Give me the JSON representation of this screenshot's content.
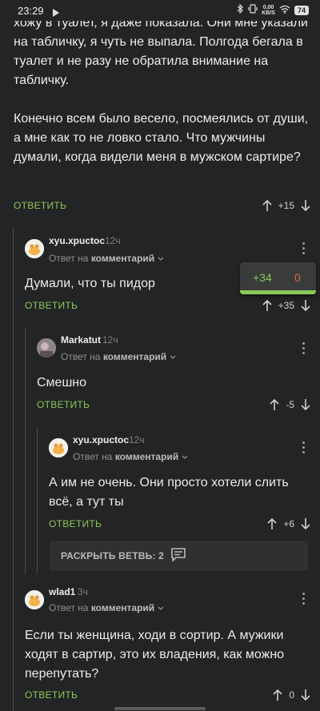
{
  "status_bar": {
    "time": "23:29",
    "net_speed_value": "0,00",
    "net_speed_unit": "KB/S",
    "battery": "74"
  },
  "top_comment": {
    "paragraph1": "хожу в туалет, я даже показала. Они мне указали на табличку, я чуть не выпала. Полгода бегала в туалет и не разу не обратила внимание на табличку.",
    "paragraph2": "Конечно всем было весело, посмеялись от души, а мне как то не ловко стало. Что мужчины думали, когда видели меня в мужском сартире?",
    "reply_label": "ОТВЕТИТЬ",
    "rating": "+15"
  },
  "comments": [
    {
      "author": "xyu.xpuctoc",
      "time": "12ч",
      "reply_prefix": "Ответ на",
      "reply_target": "комментарий",
      "text": "Думали, что ты пидор",
      "reply_label": "ОТВЕТИТЬ",
      "rating": "+35",
      "popup_positive": "+34",
      "popup_negative": "0"
    },
    {
      "author": "Markatut",
      "time": "12ч",
      "reply_prefix": "Ответ на",
      "reply_target": "комментарий",
      "text": "Смешно",
      "reply_label": "ОТВЕТИТЬ",
      "rating": "-5"
    },
    {
      "author": "xyu.xpuctoc",
      "time": "12ч",
      "reply_prefix": "Ответ на",
      "reply_target": "комментарий",
      "text": "А им не очень. Они просто хотели слить всё, а тут ты",
      "reply_label": "ОТВЕТИТЬ",
      "rating": "+6"
    },
    {
      "author": "wlad1",
      "time": "3ч",
      "reply_prefix": "Ответ на",
      "reply_target": "комментарий",
      "text": "Если ты женщина, ходи в сортир. А мужики ходят в сартир, это их владения, как можно перепутать?",
      "reply_label": "ОТВЕТИТЬ",
      "rating": "0"
    }
  ],
  "expand_branch": {
    "label": "РАСКРЫТЬ ВЕТВЬ: 2"
  },
  "colors": {
    "background": "#232425",
    "accent_green": "#8ac858",
    "negative_orange": "#e06b3d"
  },
  "icons": [
    "play-icon",
    "bluetooth-icon",
    "vibrate-icon",
    "wifi-icon",
    "battery-icon",
    "arrow-up-icon",
    "arrow-down-icon",
    "more-vertical-icon",
    "chevron-down-icon",
    "comments-icon"
  ]
}
